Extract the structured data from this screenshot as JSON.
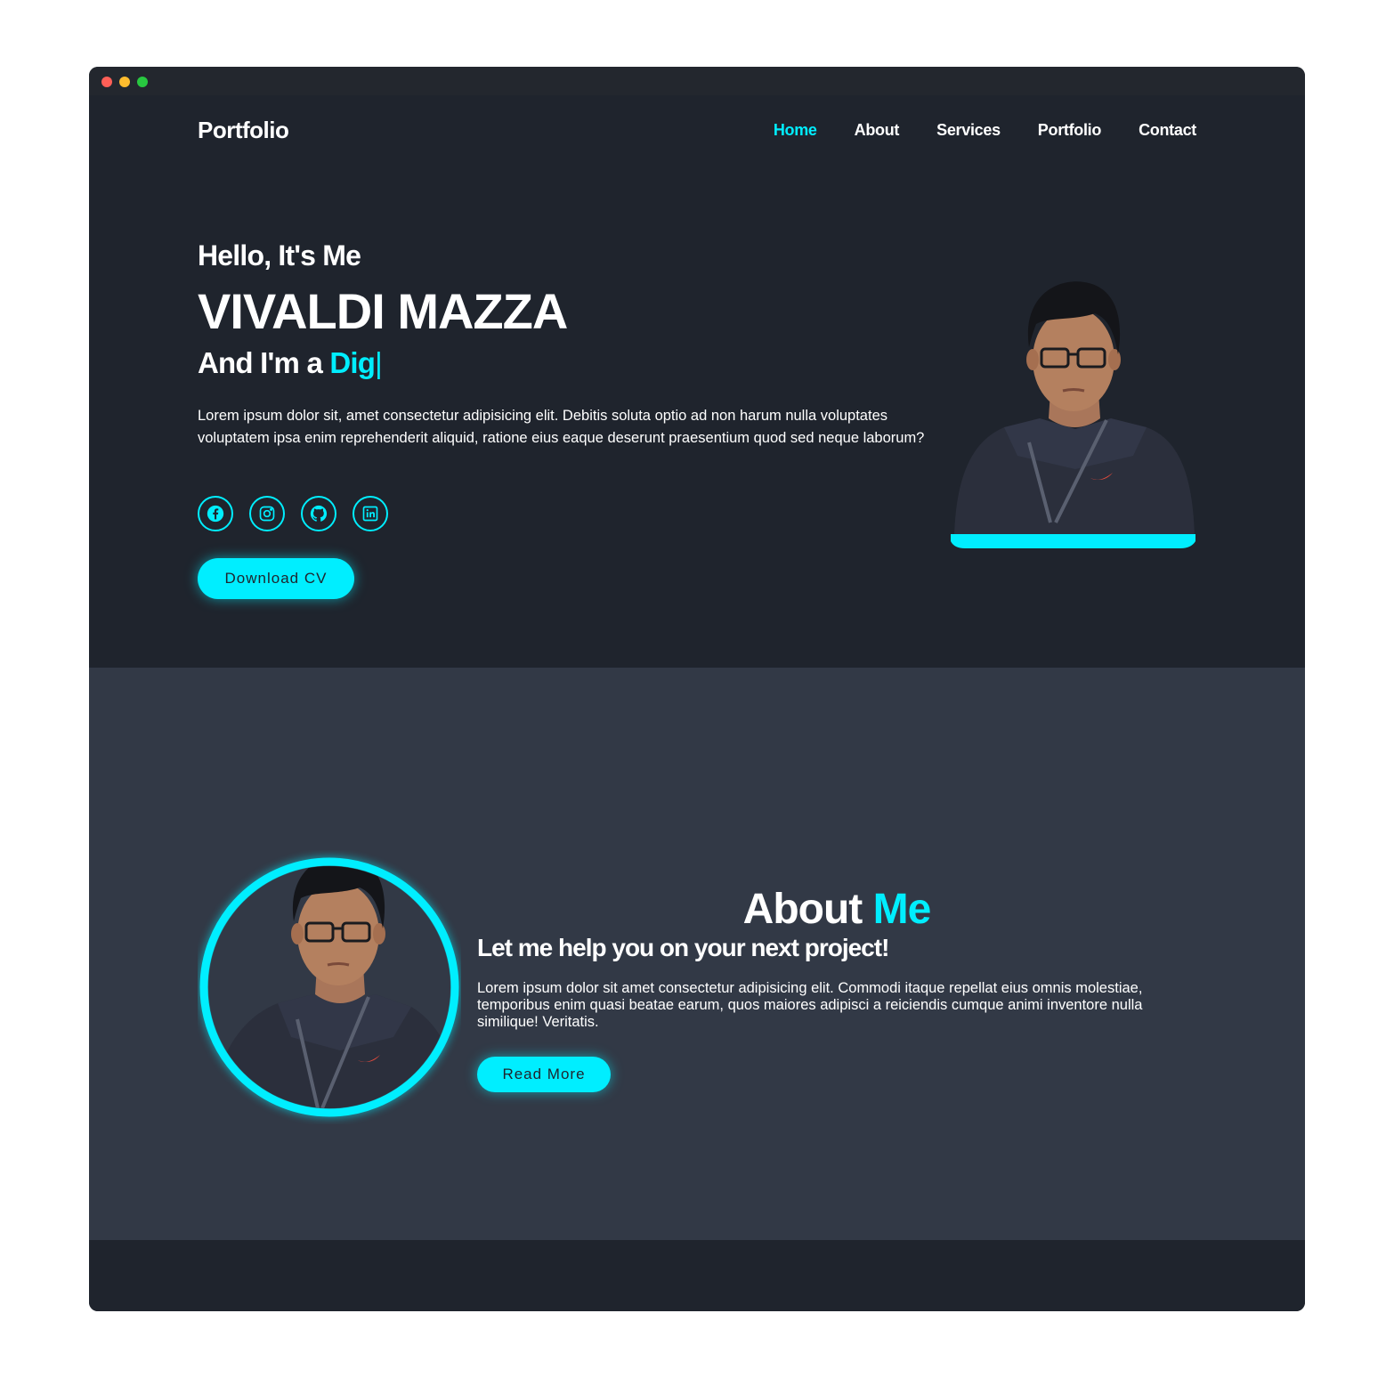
{
  "nav": {
    "logo": "Portfolio",
    "links": [
      "Home",
      "About",
      "Services",
      "Portfolio",
      "Contact"
    ],
    "active": "Home"
  },
  "hero": {
    "greeting": "Hello, It's Me",
    "name": "VIVALDI MAZZA",
    "role_prefix": "And I'm a ",
    "role_typed": "Dig",
    "role_cursor": "|",
    "description": "Lorem ipsum dolor sit, amet consectetur adipisicing elit. Debitis soluta optio ad non harum nulla voluptates voluptatem ipsa enim reprehenderit aliquid, ratione eius eaque deserunt praesentium quod sed neque laborum?",
    "socials": [
      "facebook-icon",
      "instagram-icon",
      "github-icon",
      "linkedin-icon"
    ],
    "cta": "Download CV"
  },
  "about": {
    "title": "About",
    "title_accent": "Me",
    "subtitle": "Let me help you on your next project!",
    "description": "Lorem ipsum dolor sit amet consectetur adipisicing elit. Commodi itaque repellat eius omnis molestiae, temporibus enim quasi beatae earum, quos maiores adipisci a reiciendis cumque animi inventore nulla similique! Veritatis.",
    "cta": "Read More"
  },
  "colors": {
    "accent": "#00eeff",
    "bg_dark": "#1f242d",
    "bg_section": "#323946",
    "text": "#ffffff"
  }
}
